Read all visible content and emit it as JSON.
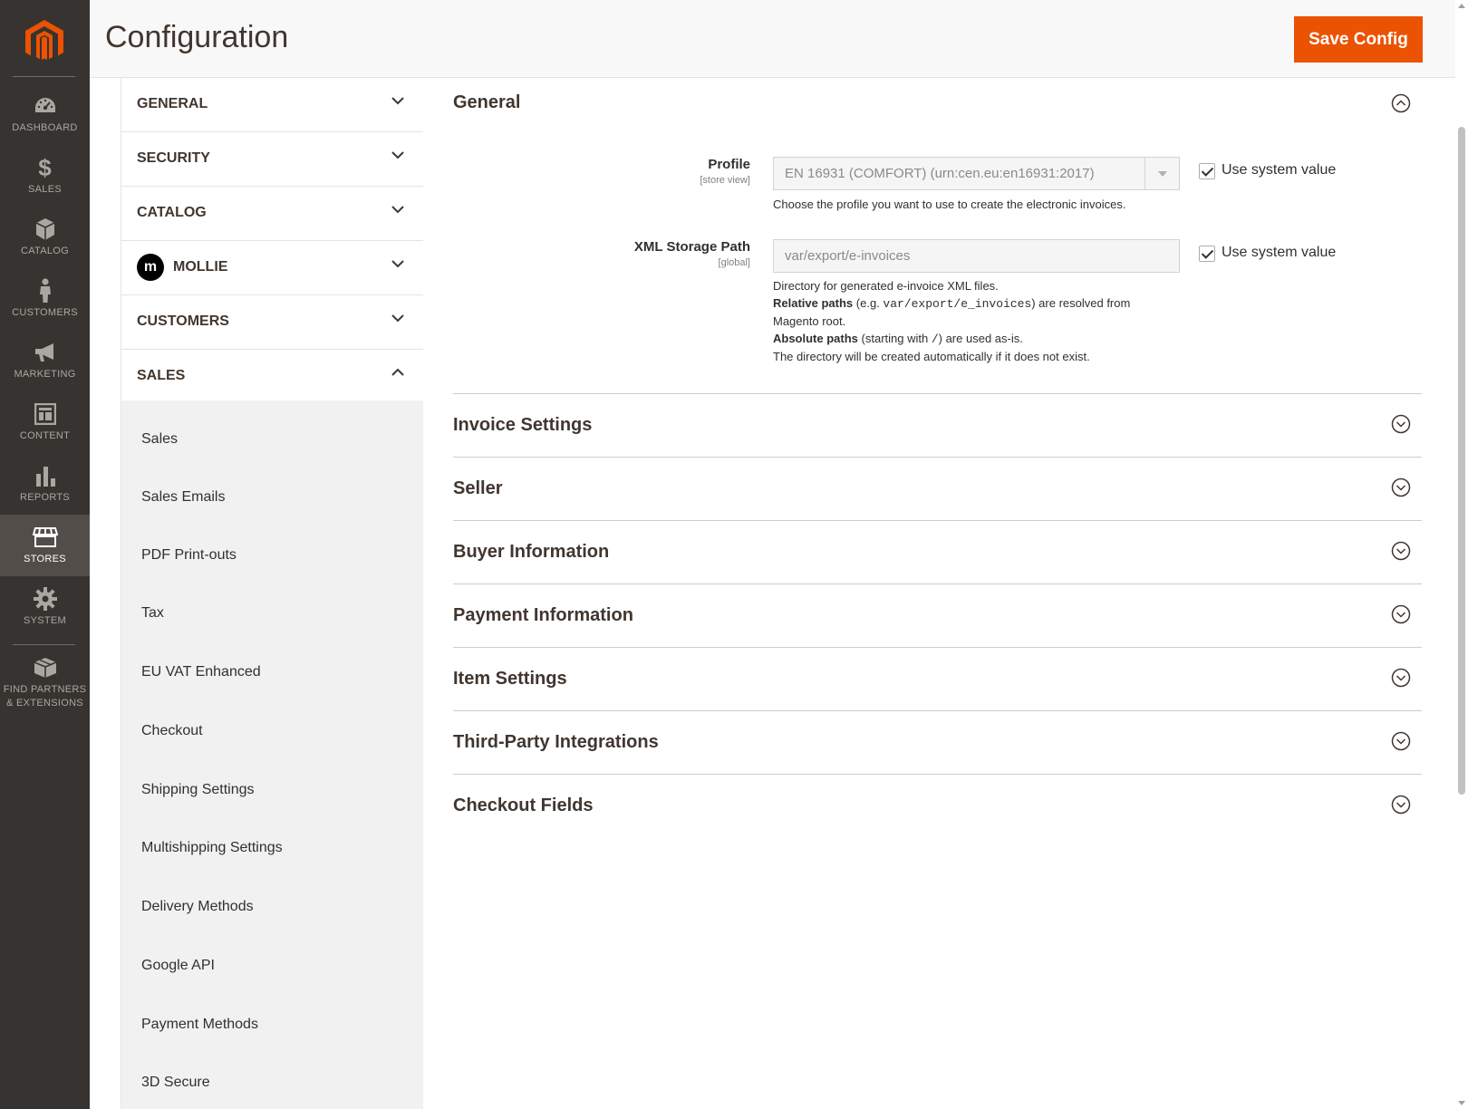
{
  "admin_nav": {
    "items": [
      {
        "label": "DASHBOARD",
        "icon": "dashboard-icon"
      },
      {
        "label": "SALES",
        "icon": "dollar-icon"
      },
      {
        "label": "CATALOG",
        "icon": "box-icon"
      },
      {
        "label": "CUSTOMERS",
        "icon": "person-icon"
      },
      {
        "label": "MARKETING",
        "icon": "megaphone-icon"
      },
      {
        "label": "CONTENT",
        "icon": "layout-icon"
      },
      {
        "label": "REPORTS",
        "icon": "bar-chart-icon"
      },
      {
        "label": "STORES",
        "icon": "store-icon"
      },
      {
        "label": "SYSTEM",
        "icon": "gear-icon"
      }
    ],
    "partners_line1": "FIND PARTNERS",
    "partners_line2": "& EXTENSIONS",
    "active": "STORES"
  },
  "header": {
    "title": "Configuration",
    "save_label": "Save Config",
    "accent_color": "#eb5202"
  },
  "tabs": {
    "items": [
      {
        "label": "GENERAL",
        "expanded": false
      },
      {
        "label": "SECURITY",
        "expanded": false
      },
      {
        "label": "CATALOG",
        "expanded": false
      },
      {
        "label": "MOLLIE",
        "expanded": false,
        "logo_letter": "m"
      },
      {
        "label": "CUSTOMERS",
        "expanded": false
      },
      {
        "label": "SALES",
        "expanded": true
      }
    ],
    "sales_links": [
      "Sales",
      "Sales Emails",
      "PDF Print-outs",
      "Tax",
      "EU VAT Enhanced",
      "Checkout",
      "Shipping Settings",
      "Multishipping Settings",
      "Delivery Methods",
      "Google API",
      "Payment Methods",
      "3D Secure"
    ]
  },
  "general_section": {
    "title": "General",
    "profile": {
      "label": "Profile",
      "scope": "[store view]",
      "value": "EN 16931 (COMFORT) (urn:cen.eu:en16931:2017)",
      "use_system_label": "Use system value",
      "use_system_checked": true,
      "note": "Choose the profile you want to use to create the electronic invoices."
    },
    "xml_path": {
      "label": "XML Storage Path",
      "scope": "[global]",
      "value": "var/export/e-invoices",
      "use_system_label": "Use system value",
      "use_system_checked": true,
      "note_line1": "Directory for generated e-invoice XML files.",
      "note_rel_bold": "Relative paths",
      "note_rel_pre": " (e.g. ",
      "note_rel_code": "var/export/e_invoices",
      "note_rel_post": ") are resolved from",
      "note_line3": "Magento root.",
      "note_abs_bold": "Absolute paths",
      "note_abs_pre": " (starting with ",
      "note_abs_code": "/",
      "note_abs_post": ") are used as-is.",
      "note_line5": "The directory will be created automatically if it does not exist."
    }
  },
  "collapsed_sections": [
    "Invoice Settings",
    "Seller",
    "Buyer Information",
    "Payment Information",
    "Item Settings",
    "Third-Party Integrations",
    "Checkout Fields"
  ]
}
